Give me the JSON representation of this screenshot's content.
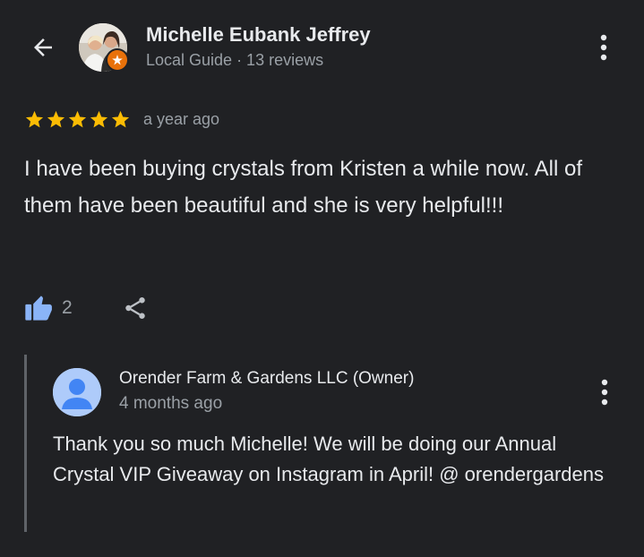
{
  "reviewer": {
    "name": "Michelle Eubank Jeffrey",
    "meta": "Local Guide · 13 reviews"
  },
  "review": {
    "rating": 5,
    "time_ago": "a year ago",
    "text": "I have been buying crystals from Kristen a while now. All of them have been beautiful and she is very helpful!!!",
    "likes": "2"
  },
  "reply": {
    "owner_name": "Orender Farm & Gardens LLC (Owner)",
    "time_ago": "4 months ago",
    "text": "Thank you so much Michelle! We will be doing our Annual Crystal VIP Giveaway on Instagram in April! @ orendergardens"
  },
  "icons": {
    "back": "arrow-back-icon",
    "more": "more-vert-icon",
    "star": "star-icon",
    "like": "thumb-up-icon",
    "share": "share-icon",
    "guide_badge": "local-guide-badge-icon",
    "owner_avatar": "person-icon"
  },
  "colors": {
    "background": "#202124",
    "star": "#fbbc04",
    "like": "#8ab4f8",
    "guide_badge": "#e8710a",
    "owner_avatar": "#aecbfa"
  }
}
